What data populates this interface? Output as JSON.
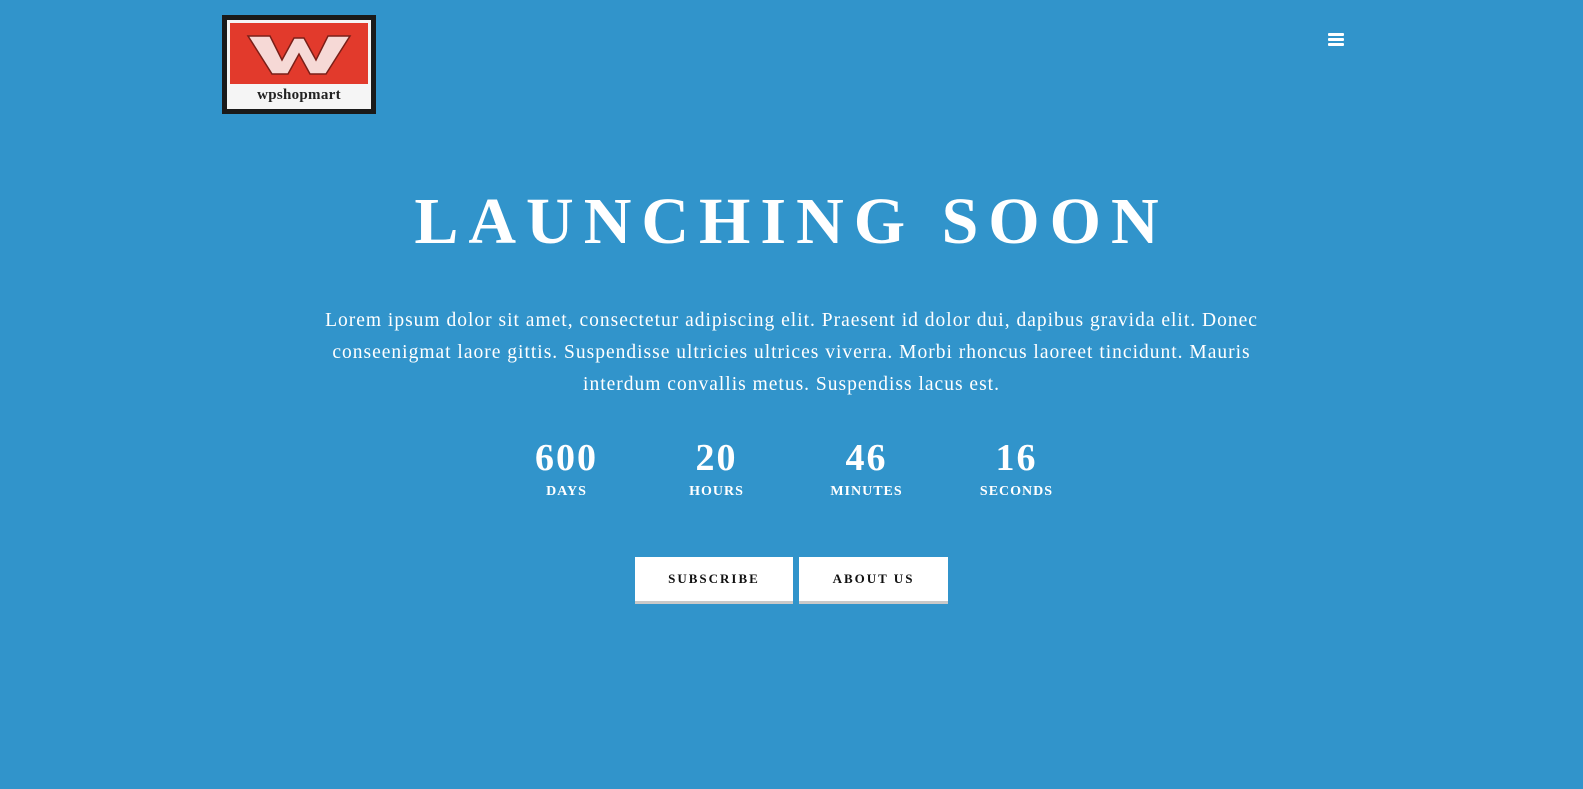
{
  "logo": {
    "text": "wpshopmart"
  },
  "nav": {
    "menu_icon": "hamburger-menu-icon"
  },
  "hero": {
    "title": "LAUNCHING SOON",
    "description": "Lorem ipsum dolor sit amet, consectetur adipiscing elit. Praesent id dolor dui, dapibus gravida elit. Donec conseenigmat laore gittis. Suspendisse ultricies ultrices viverra. Morbi rhoncus laoreet tincidunt. Mauris interdum convallis metus. Suspendiss lacus est."
  },
  "countdown": {
    "days": {
      "value": "600",
      "label": "DAYS"
    },
    "hours": {
      "value": "20",
      "label": "HOURS"
    },
    "minutes": {
      "value": "46",
      "label": "MINUTES"
    },
    "seconds": {
      "value": "16",
      "label": "SECONDS"
    }
  },
  "buttons": {
    "subscribe": "SUBSCRIBE",
    "about": "ABOUT US"
  },
  "colors": {
    "background": "#3194cb",
    "logo_red": "#e23a2c",
    "text": "#ffffff"
  }
}
